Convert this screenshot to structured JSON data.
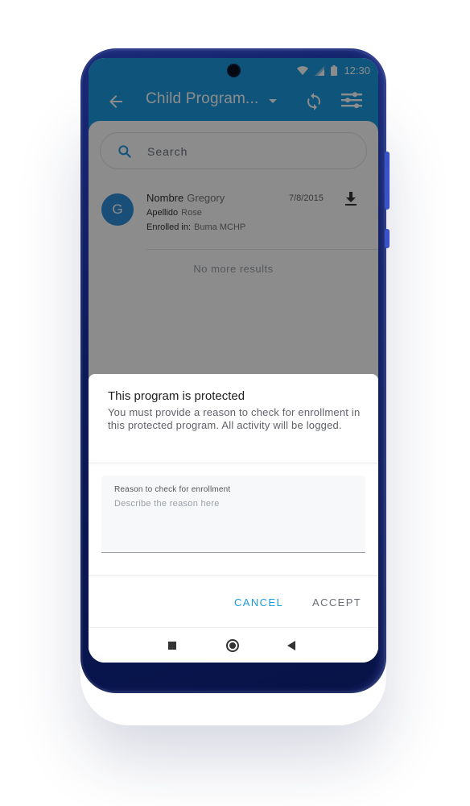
{
  "status_bar": {
    "time": "12:30"
  },
  "app_bar": {
    "title": "Child Program...",
    "title_icon": "chevron-down-icon",
    "back_icon": "arrow-back-icon",
    "sync_icon": "sync-icon",
    "filter_icon": "filter-icon"
  },
  "search": {
    "placeholder": "Search",
    "icon": "search-icon"
  },
  "result": {
    "avatar_letter": "G",
    "first_name_label": "Nombre",
    "first_name": "Gregory",
    "last_name_label": "Apellido",
    "last_name": "Rose",
    "enrolled_label": "Enrolled in:",
    "enrolled_value": "Buma MCHP",
    "date": "7/8/2015",
    "download_icon": "download-icon"
  },
  "list_footer": "No more results",
  "dialog": {
    "title": "This program is protected",
    "message": "You must provide a reason to check for enrollment in this protected program. All activity will be logged.",
    "field_label": "Reason to check for enrollment",
    "field_placeholder": "Describe the reason here",
    "field_value": "",
    "cancel": "CANCEL",
    "accept": "ACCEPT"
  },
  "colors": {
    "primary": "#1d9be0",
    "phone_body": "#0c1a58",
    "accept_disabled": "#6b6f75"
  }
}
